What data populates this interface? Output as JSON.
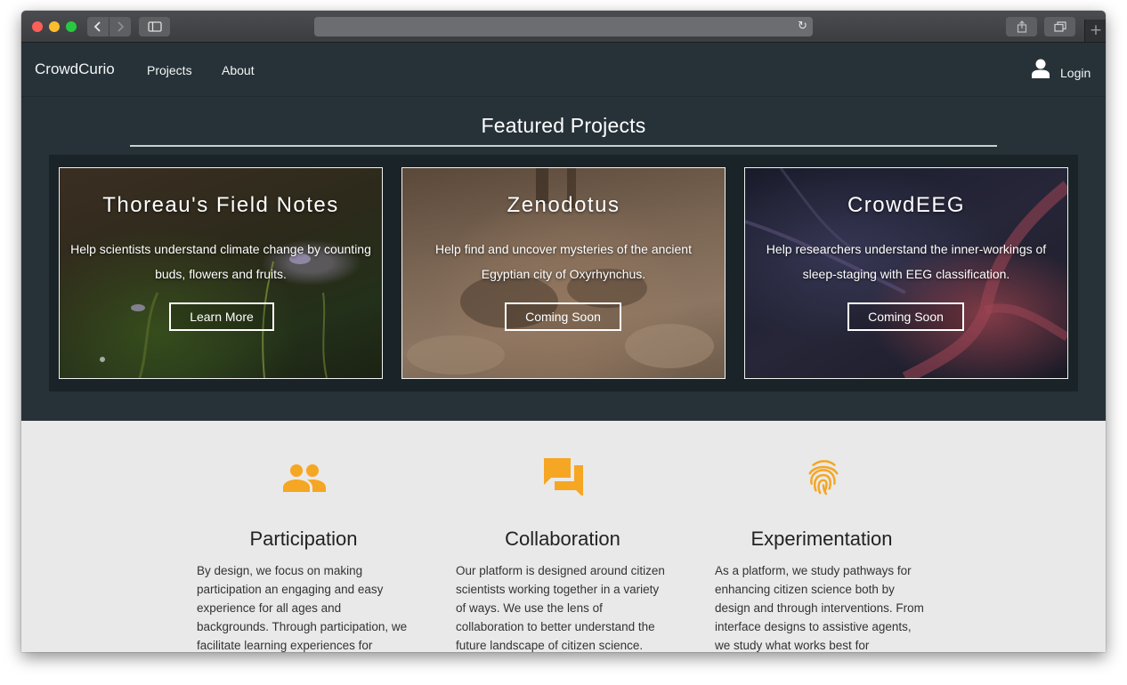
{
  "browser": {
    "back_icon": "chevron-left-icon",
    "forward_icon": "chevron-right-icon",
    "sidebar_icon": "sidebar-icon",
    "reload_icon": "reload-icon",
    "share_icon": "share-icon",
    "tabs_icon": "tabs-icon",
    "new_tab_label": "+"
  },
  "nav": {
    "brand": "CrowdCurio",
    "links": [
      "Projects",
      "About"
    ],
    "login_label": "Login",
    "login_icon": "user-icon"
  },
  "featured": {
    "title": "Featured Projects",
    "cards": [
      {
        "title": "Thoreau's Field Notes",
        "description": "Help scientists understand climate change by counting buds, flowers and fruits.",
        "button": "Learn More"
      },
      {
        "title": "Zenodotus",
        "description": "Help find and uncover mysteries of the ancient Egyptian city of Oxyrhynchus.",
        "button": "Coming Soon"
      },
      {
        "title": "CrowdEEG",
        "description": "Help researchers understand the inner-workings of sleep-staging with EEG classification.",
        "button": "Coming Soon"
      }
    ]
  },
  "features": [
    {
      "icon": "people-icon",
      "title": "Participation",
      "text": "By design, we focus on making participation an engaging and easy experience for all ages and backgrounds. Through participation, we facilitate learning experiences for"
    },
    {
      "icon": "chat-bubbles-icon",
      "title": "Collaboration",
      "text": "Our platform is designed around citizen scientists working together in a variety of ways. We use the lens of collaboration to better understand the future landscape of citizen science."
    },
    {
      "icon": "fingerprint-icon",
      "title": "Experimentation",
      "text": "As a platform, we study pathways for enhancing citizen science both by design and through interventions. From interface designs to assistive agents, we study what works best for"
    }
  ],
  "colors": {
    "nav_bg": "#263238",
    "accent": "#f5a623",
    "features_bg": "#e9e9e9"
  }
}
